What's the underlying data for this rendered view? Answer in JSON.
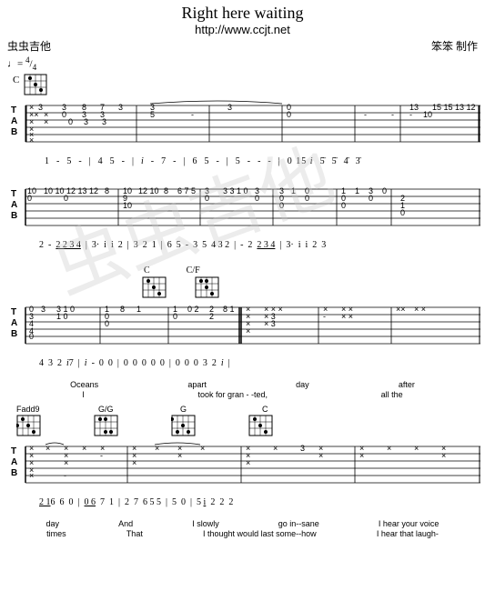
{
  "title": "Right here waiting",
  "subtitle": "http://www.ccjt.net",
  "left_label": "虫虫吉他",
  "right_label": "笨笨 制作",
  "tempo": "♩= 4/4",
  "watermark": "虫虫吉他",
  "sections": [
    {
      "chord_name": "C",
      "tab_lines": [
        "T|--×--3---3--8--7--3------3-------|13|15151312|",
        "A|--××-×---0--3---3----5----|0-------|",
        "B|--×--×-----0--3---3-----------10--|"
      ],
      "numbers": "1  - 5 - | 4  5 - | i - 7 - | 6  5 - | 5  - - - | 0 15 i  5 5 4 3"
    }
  ],
  "lyrics_sections": [
    {
      "words": [
        "Oceans",
        "apart",
        "day",
        "after"
      ],
      "words2": [
        "I",
        "took for gran",
        "--ted,",
        "all the"
      ]
    },
    {
      "words": [
        "day",
        "",
        "And",
        "I slowly",
        "go",
        "in--sane",
        "",
        "I hear your voice"
      ],
      "words2": [
        "times",
        "",
        "That",
        "I thought would last some--how",
        "",
        "I hear that laugh-"
      ]
    }
  ]
}
